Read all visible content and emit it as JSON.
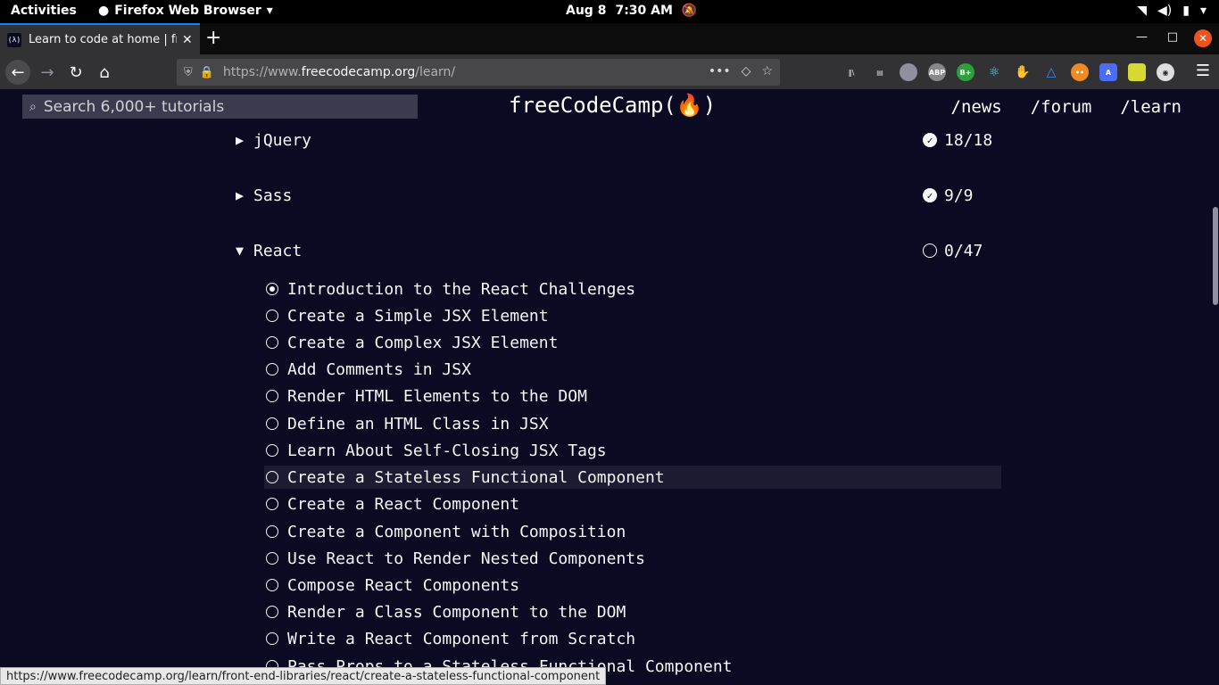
{
  "gnome": {
    "activities": "Activities",
    "app_name": "Firefox Web Browser",
    "date": "Aug 8",
    "time": "7:30 AM"
  },
  "browser": {
    "tab_title": "Learn to code at home | freeCodeCamp.org",
    "url_prefix": "https://www.",
    "url_domain": "freecodecamp.org",
    "url_path": "/learn/",
    "status_url": "https://www.freecodecamp.org/learn/front-end-libraries/react/create-a-stateless-functional-component"
  },
  "fcc_nav": {
    "search_placeholder": "Search 6,000+ tutorials",
    "logo": "freeCodeCamp(🔥)",
    "links": [
      "/news",
      "/forum",
      "/learn"
    ]
  },
  "blocks": [
    {
      "arrow": "▶",
      "name": "jQuery",
      "count": "18/18",
      "complete": true
    },
    {
      "arrow": "▶",
      "name": "Sass",
      "count": "9/9",
      "complete": true
    },
    {
      "arrow": "▼",
      "name": "React",
      "count": "0/47",
      "complete": false
    }
  ],
  "challenges": [
    "Introduction to the React Challenges",
    "Create a Simple JSX Element",
    "Create a Complex JSX Element",
    "Add Comments in JSX",
    "Render HTML Elements to the DOM",
    "Define an HTML Class in JSX",
    "Learn About Self-Closing JSX Tags",
    "Create a Stateless Functional Component",
    "Create a React Component",
    "Create a Component with Composition",
    "Use React to Render Nested Components",
    "Compose React Components",
    "Render a Class Component to the DOM",
    "Write a React Component from Scratch",
    "Pass Props to a Stateless Functional Component"
  ],
  "colors": {
    "bg": "#0a0a23",
    "fg": "#f5f6f7",
    "hover_row": "#1b1b32"
  }
}
